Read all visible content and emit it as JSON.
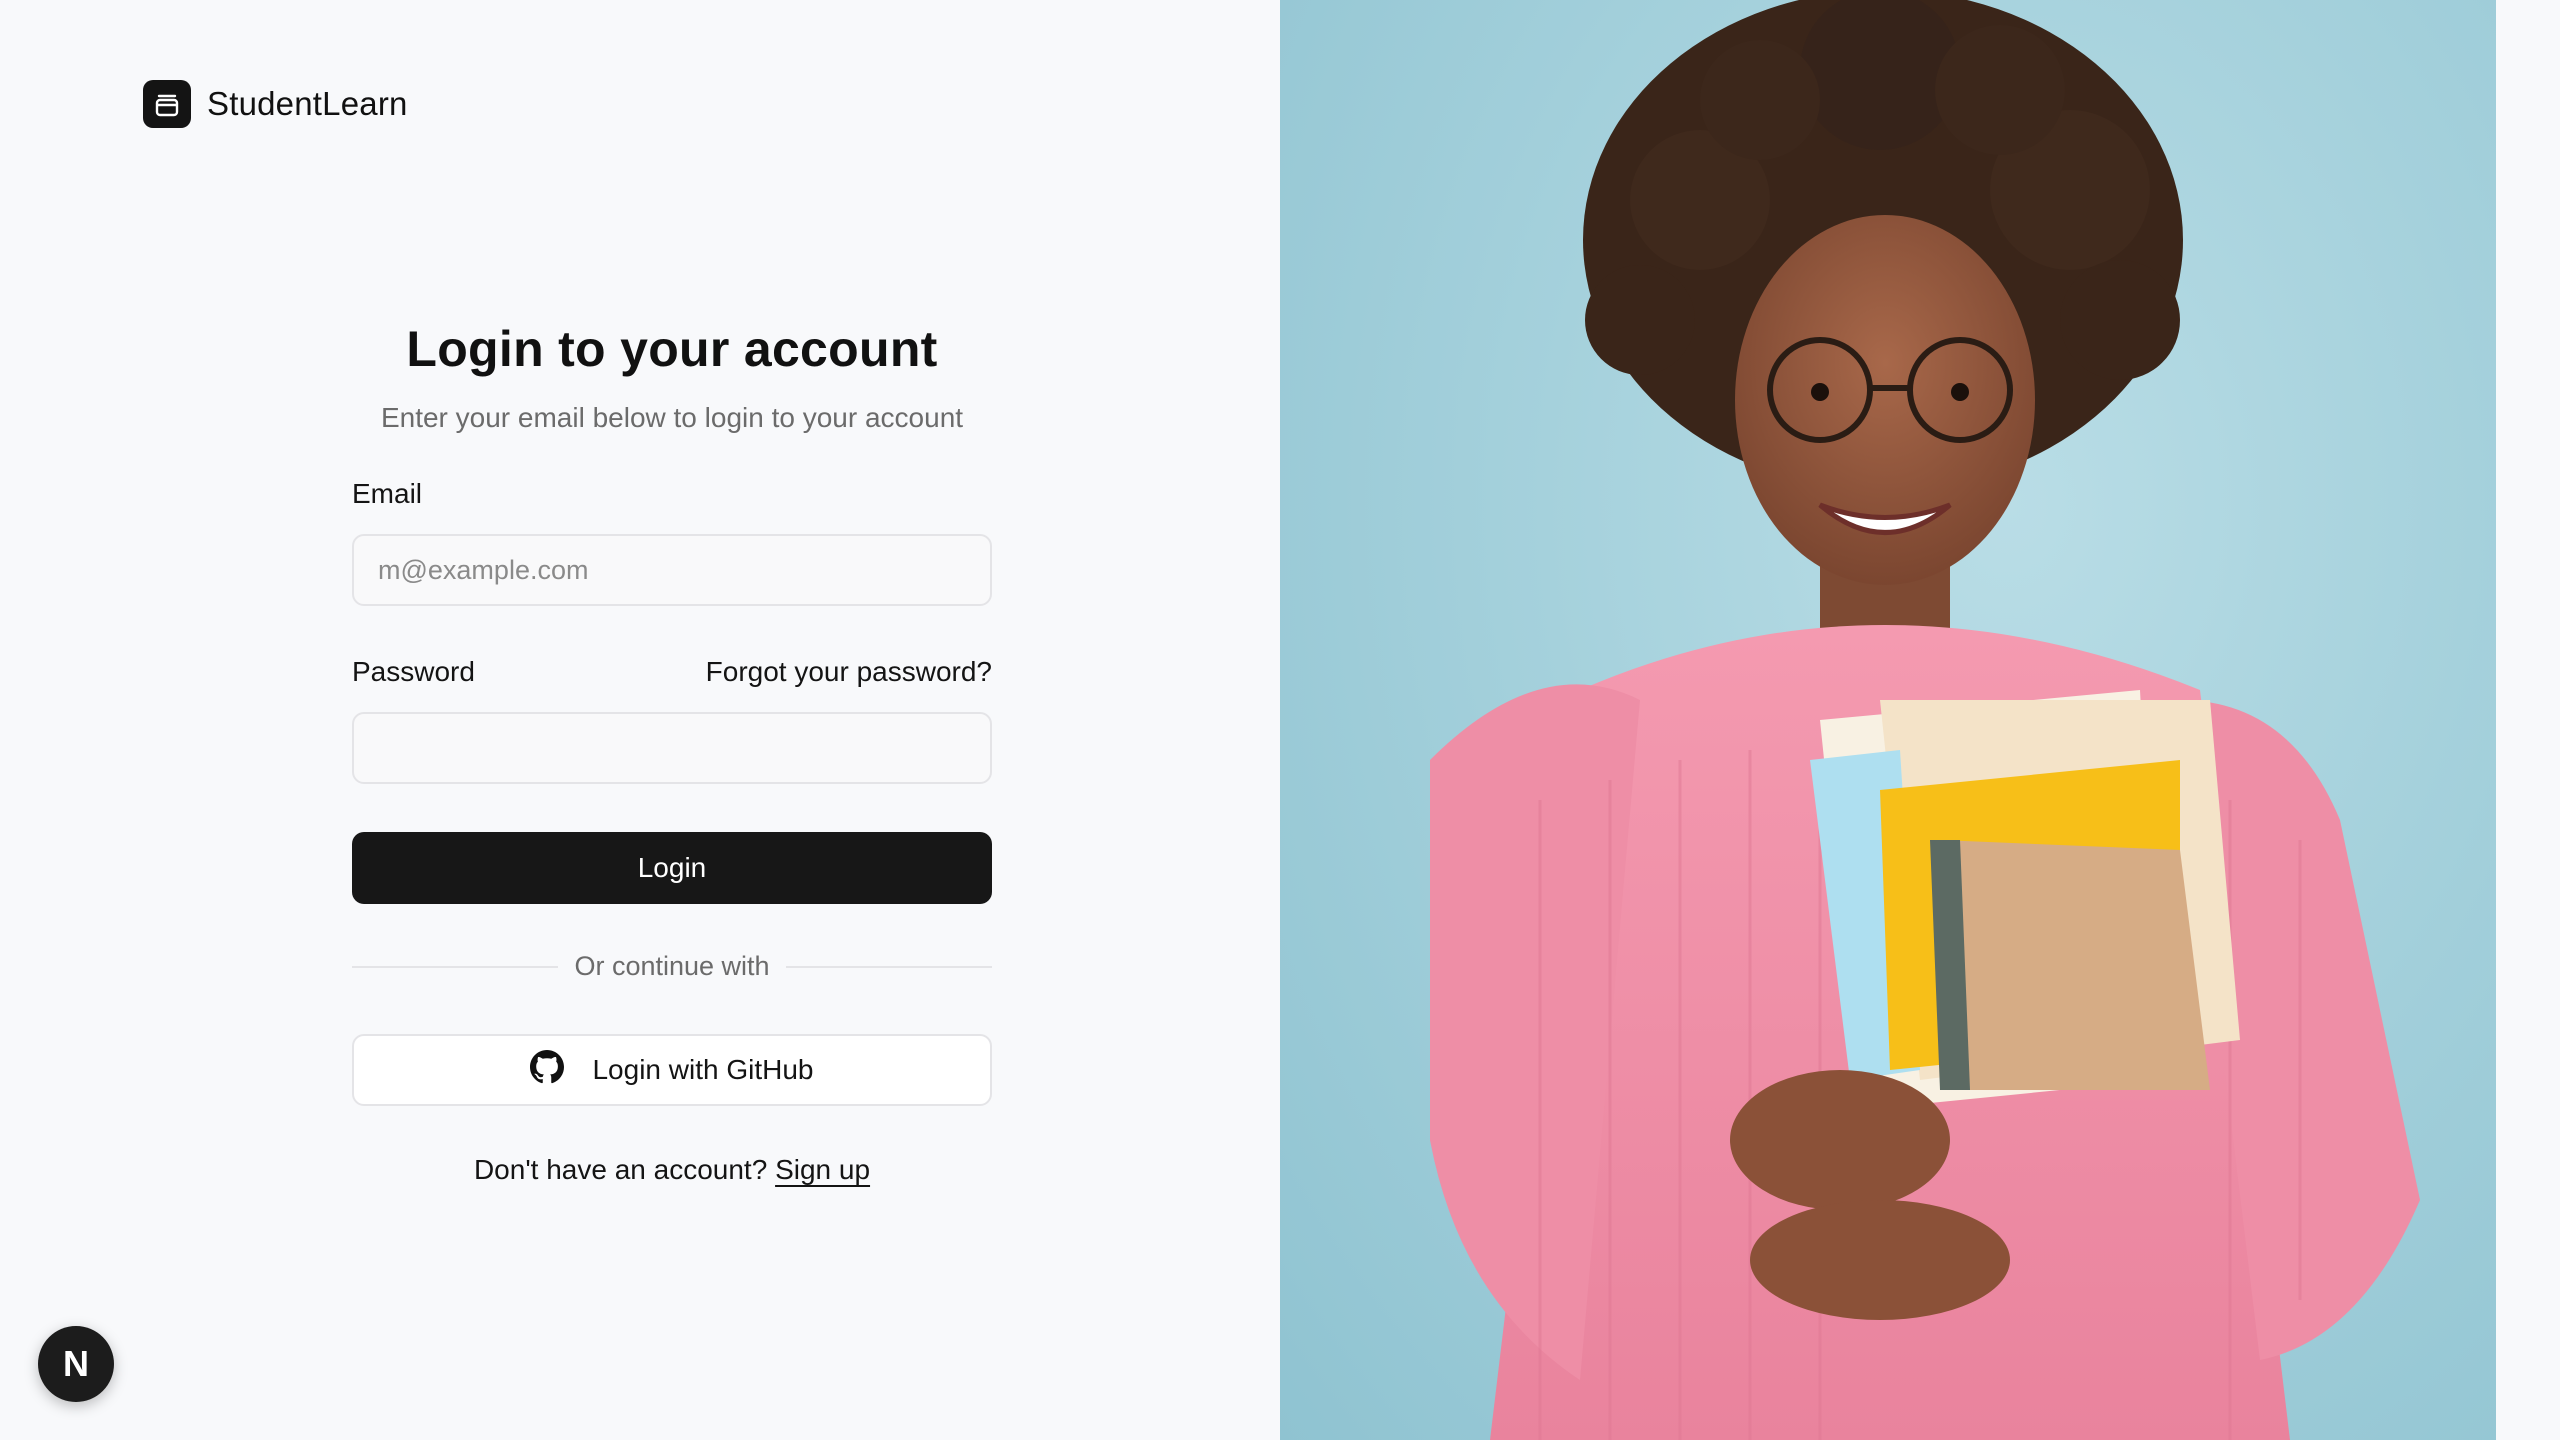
{
  "brand": {
    "name": "StudentLearn",
    "logo_icon": "layers-icon"
  },
  "form": {
    "title": "Login to your account",
    "subtitle": "Enter your email below to login to your account",
    "email_label": "Email",
    "email_placeholder": "m@example.com",
    "email_value": "",
    "password_label": "Password",
    "forgot_link": "Forgot your password?",
    "password_value": "",
    "login_button": "Login",
    "divider_text": "Or continue with",
    "github_button": "Login with GitHub",
    "github_icon": "github-icon",
    "signup_prompt": "Don't have an account?",
    "signup_link": "Sign up"
  },
  "dev_badge": {
    "letter": "N"
  },
  "colors": {
    "left_bg": "#f8f9fb",
    "primary_button": "#171717",
    "photo_bg": "#a5d1dc",
    "sweater": "#f28fa6"
  }
}
